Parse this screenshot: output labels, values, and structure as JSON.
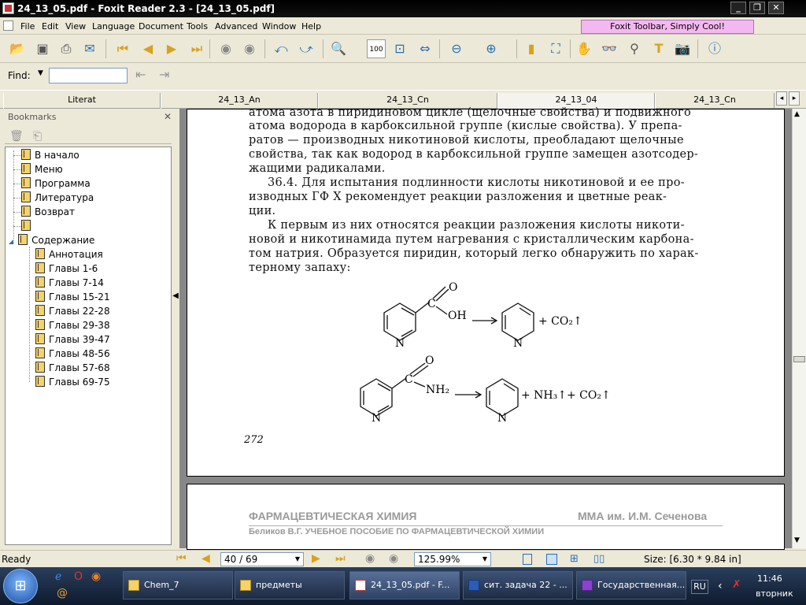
{
  "window": {
    "title": "24_13_05.pdf - Foxit Reader 2.3 - [24_13_05.pdf]"
  },
  "menu": [
    "File",
    "Edit",
    "View",
    "Language",
    "Document",
    "Tools",
    "Advanced",
    "Window",
    "Help"
  ],
  "banner": "Foxit Toolbar, Simply Cool!",
  "find": {
    "label": "Find:",
    "value": ""
  },
  "tabs": [
    "Literat",
    "24_13_An",
    "24_13_Cn",
    "24_13_04",
    "24_13_Cn"
  ],
  "bookmarks": {
    "header": "Bookmarks",
    "items": [
      "В начало",
      "Меню",
      "Программа",
      "Литература",
      "Возврат",
      "",
      "Содержание"
    ],
    "children": [
      "Аннотация",
      "Главы 1-6",
      "Главы 7-14",
      "Главы 15-21",
      "Главы 22-28",
      "Главы 29-38",
      "Главы 39-47",
      "Главы 48-56",
      "Главы 57-68",
      "Главы 69-75"
    ]
  },
  "page1": {
    "lines": [
      "атома азота в пиридиновом цикле (щелочные свойства) и подвижного",
      "атома водорода в карбоксильной группе (кислые свойства). У препа-",
      "ратов — производных никотиновой кислоты, преобладают щелочные",
      "свойства, так как водород в карбоксильной группе замещен азотсодер-",
      "жащими радикалами.",
      "36.4. Для испытания подлинности кислоты никотиновой и ее про-",
      "изводных ГФ X рекомендует реакции разложения и цветные реак-",
      "ции.",
      "К первым из них относятся реакции разложения кислоты никоти-",
      "новой и никотинамида путем нагревания с кристаллическим карбона-",
      "том натрия. Образуется пиридин, который легко обнаружить по харак-",
      "терному запаху:"
    ],
    "page_number": "272",
    "reaction1": {
      "o": "O",
      "oh": "OH",
      "c": "C",
      "n": "N",
      "product_n": "N",
      "plus_co2": "+ CO₂↑"
    },
    "reaction2": {
      "o": "O",
      "nh2": "NH₂",
      "c": "C",
      "n": "N",
      "product_n": "N",
      "plus_nh3": "+ NH₃↑",
      "plus_co2": "+ CO₂↑"
    }
  },
  "page2": {
    "title_left": "ФАРМАЦЕВТИЧЕСКАЯ ХИМИЯ",
    "title_right": "ММА им. И.М. Сеченова",
    "subtitle": "Беликов В.Г. УЧЕБНОЕ ПОСОБИЕ ПО ФАРМАЦЕВТИЧЕСКОЙ ХИМИИ"
  },
  "status": {
    "ready": "Ready",
    "page": "40 / 69",
    "zoom": "125.99%",
    "size": "Size: [6.30 * 9.84 in]"
  },
  "taskbar": {
    "items": [
      "Chem_7",
      "предметы",
      "24_13_05.pdf - F...",
      "сит. задача 22 - ...",
      "Государственная..."
    ],
    "lang": "RU",
    "time": "11:46",
    "day": "вторник"
  }
}
